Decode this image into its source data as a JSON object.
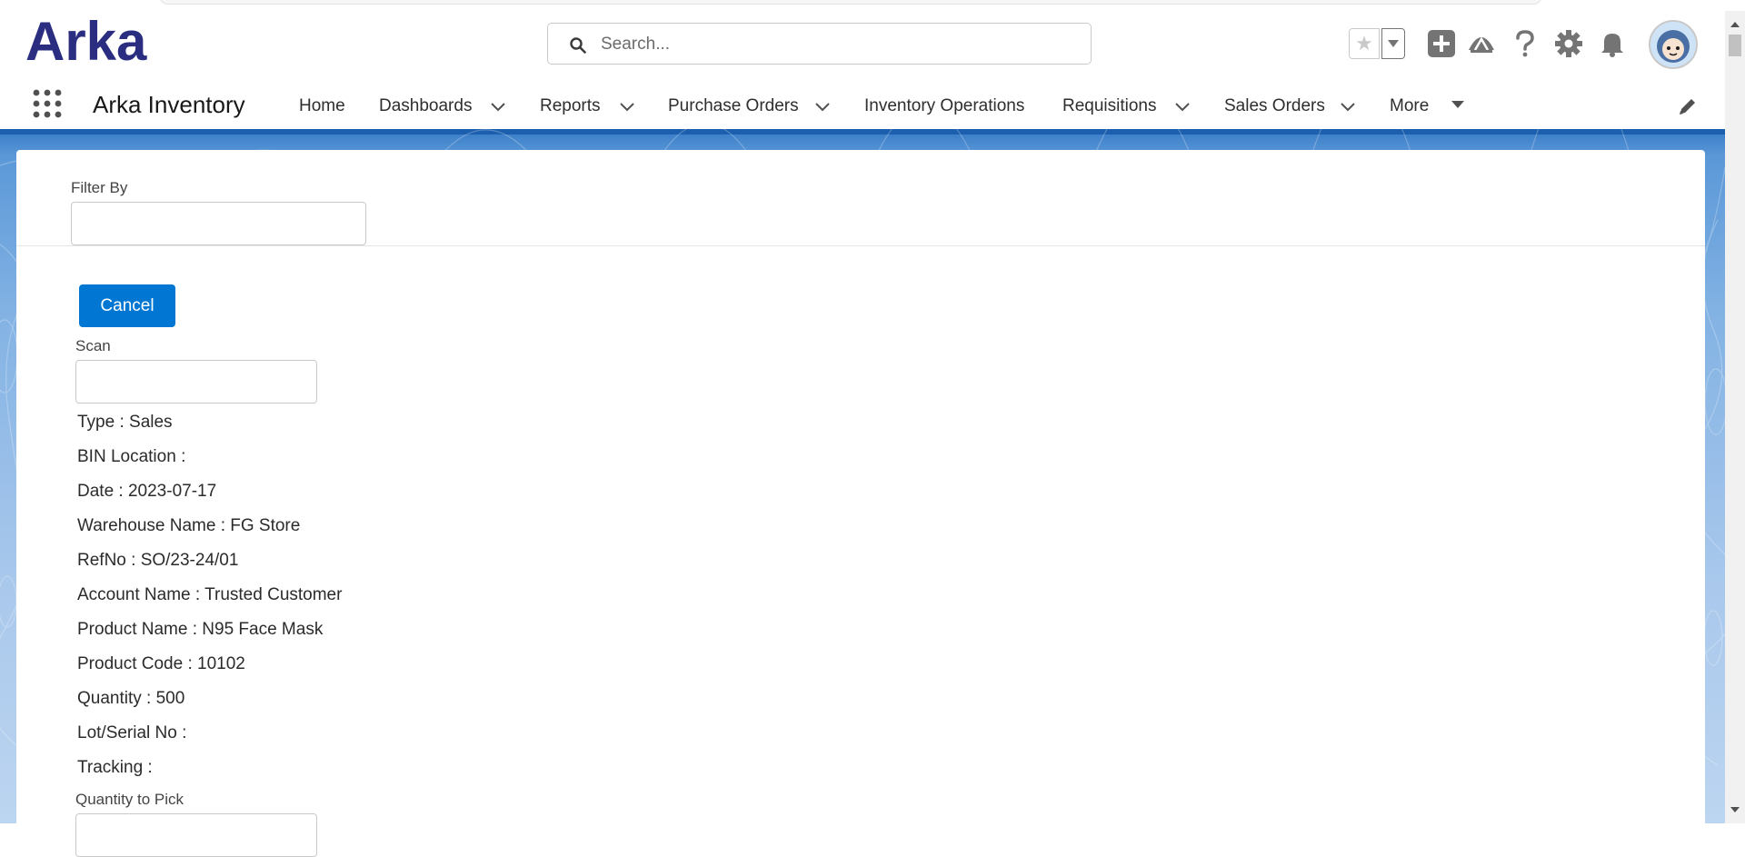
{
  "header": {
    "logo_text": "Arka",
    "search_placeholder": "Search...",
    "icons": [
      "star-icon",
      "chevron-down-icon",
      "add-icon",
      "trailhead-icon",
      "help-icon",
      "gear-icon",
      "bell-icon",
      "avatar"
    ]
  },
  "nav": {
    "app_name": "Arka Inventory",
    "items": [
      "Home",
      "Dashboards",
      "Reports",
      "Purchase Orders",
      "Inventory Operations",
      "Requisitions",
      "Sales Orders",
      "More"
    ]
  },
  "form": {
    "filter_label": "Filter By",
    "filter_value": "",
    "cancel_label": "Cancel",
    "scan_label": "Scan",
    "scan_value": "",
    "details": [
      "Type : Sales",
      "BIN Location :",
      "Date : 2023-07-17",
      "Warehouse Name : FG Store",
      "RefNo : SO/23-24/01",
      "Account Name : Trusted Customer",
      "Product Name : N95 Face Mask",
      "Product Code : 10102",
      "Quantity : 500",
      "Lot/Serial No :",
      "Tracking :"
    ],
    "qty_pick_label": "Quantity to Pick"
  },
  "colors": {
    "brand": "#2b2e80",
    "button": "#0176d3",
    "banner": "#1b5fae"
  }
}
